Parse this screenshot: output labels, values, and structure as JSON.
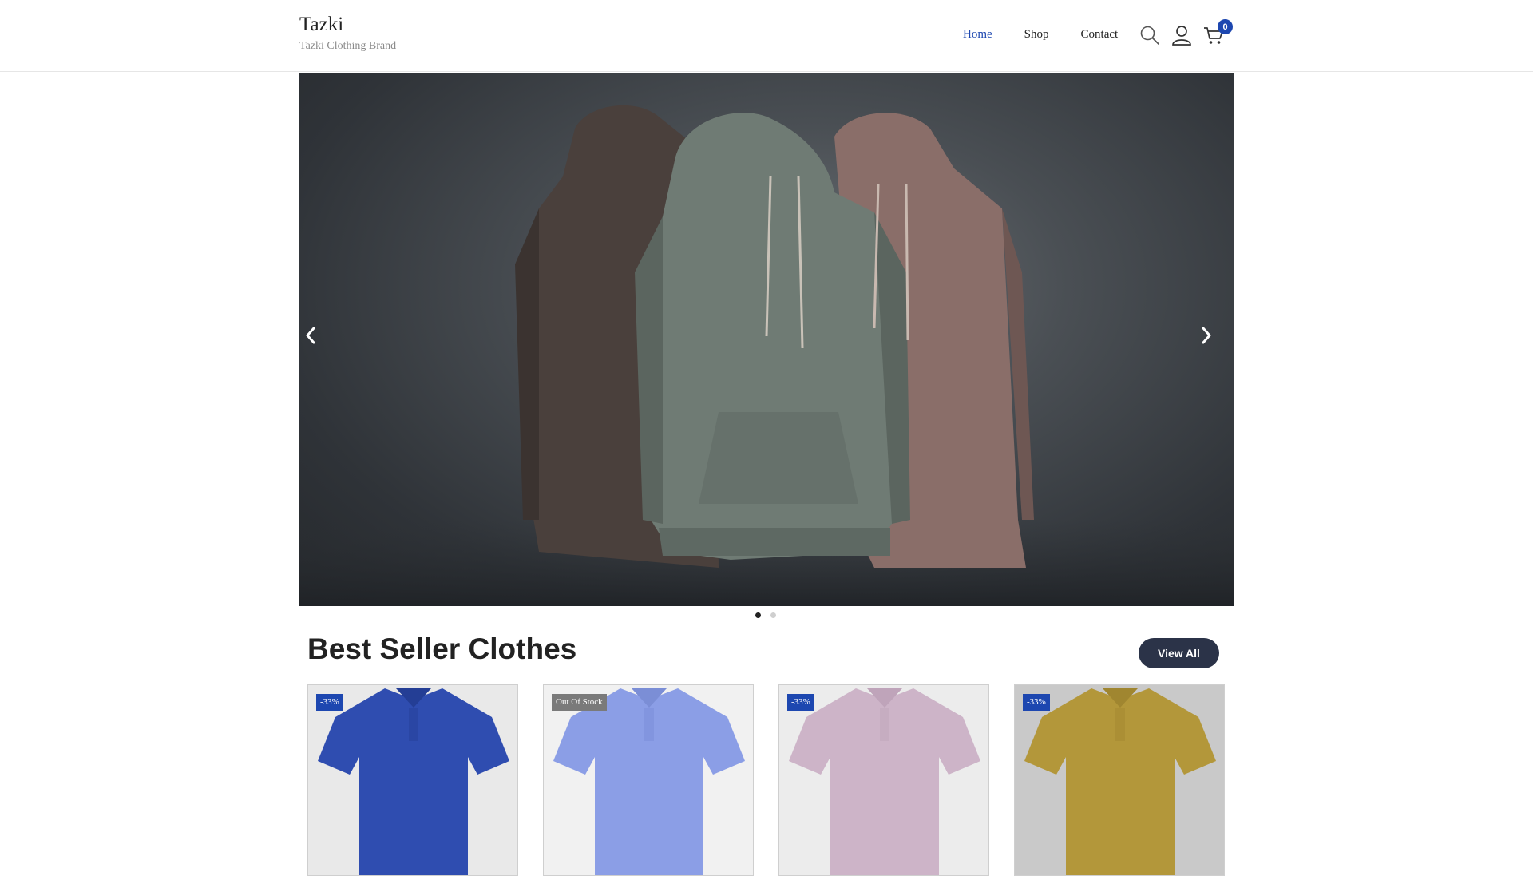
{
  "brand": {
    "name": "Tazki",
    "tagline": "Tazki Clothing Brand"
  },
  "nav": {
    "items": [
      {
        "label": "Home",
        "active": true
      },
      {
        "label": "Shop",
        "active": false
      },
      {
        "label": "Contact",
        "active": false
      }
    ]
  },
  "header_icons": [
    "search-icon",
    "user-icon",
    "cart-icon"
  ],
  "cart": {
    "count": "0"
  },
  "hero": {
    "image": "three hoodies on display (brown, sage green, dusty pink)",
    "slide_count": 2,
    "active_slide": 1
  },
  "section": {
    "title": "Best Seller Clothes",
    "view_all_label": "View All"
  },
  "products": [
    {
      "badge": "-33%",
      "badge_color": "#1d47b0",
      "shirt_color": "#2f4db0",
      "bg": "#e9e9e9"
    },
    {
      "badge": "Out Of Stock",
      "badge_color": "#7a7a7a",
      "shirt_color": "#8b9ee6",
      "bg": "#f1f1f1"
    },
    {
      "badge": "-33%",
      "badge_color": "#1d47b0",
      "shirt_color": "#cdb4c8",
      "bg": "#ececec"
    },
    {
      "badge": "-33%",
      "badge_color": "#1d47b0",
      "shirt_color": "#b3973a",
      "bg": "#c9c9c9"
    }
  ],
  "colors": {
    "accent": "#1d47b0",
    "button": "#2b3348"
  }
}
